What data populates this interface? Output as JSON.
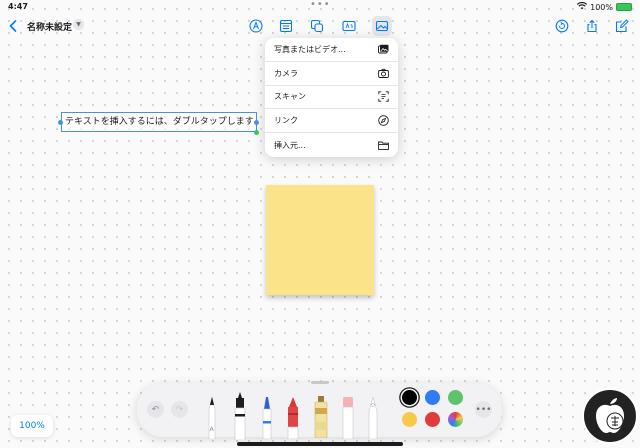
{
  "status": {
    "time": "4:47",
    "battery": "100%"
  },
  "document": {
    "title": "名称未設定"
  },
  "insert_menu": {
    "items": [
      {
        "label": "写真またはビデオ...",
        "icon": "photo-icon"
      },
      {
        "label": "カメラ",
        "icon": "camera-icon"
      },
      {
        "label": "スキャン",
        "icon": "scan-icon"
      },
      {
        "label": "リンク",
        "icon": "link-icon"
      },
      {
        "label": "挿入元...",
        "icon": "folder-icon"
      }
    ]
  },
  "canvas": {
    "text_box": "テキストを挿入するには、ダブルタップします",
    "sticky_note_color": "#fbe38a"
  },
  "zoom": {
    "level": "100%"
  },
  "palette": {
    "tools": [
      "monoline-pen",
      "fountain-pen",
      "marker",
      "crayon",
      "watercolor-brush",
      "eraser",
      "lasso"
    ],
    "colors": [
      "#000000",
      "#2f7cf6",
      "#5cc46a",
      "#f6c94a",
      "#e23b3b",
      "multicolor"
    ],
    "selected_color": "#000000"
  },
  "colors": {
    "accent": "#007aff"
  }
}
